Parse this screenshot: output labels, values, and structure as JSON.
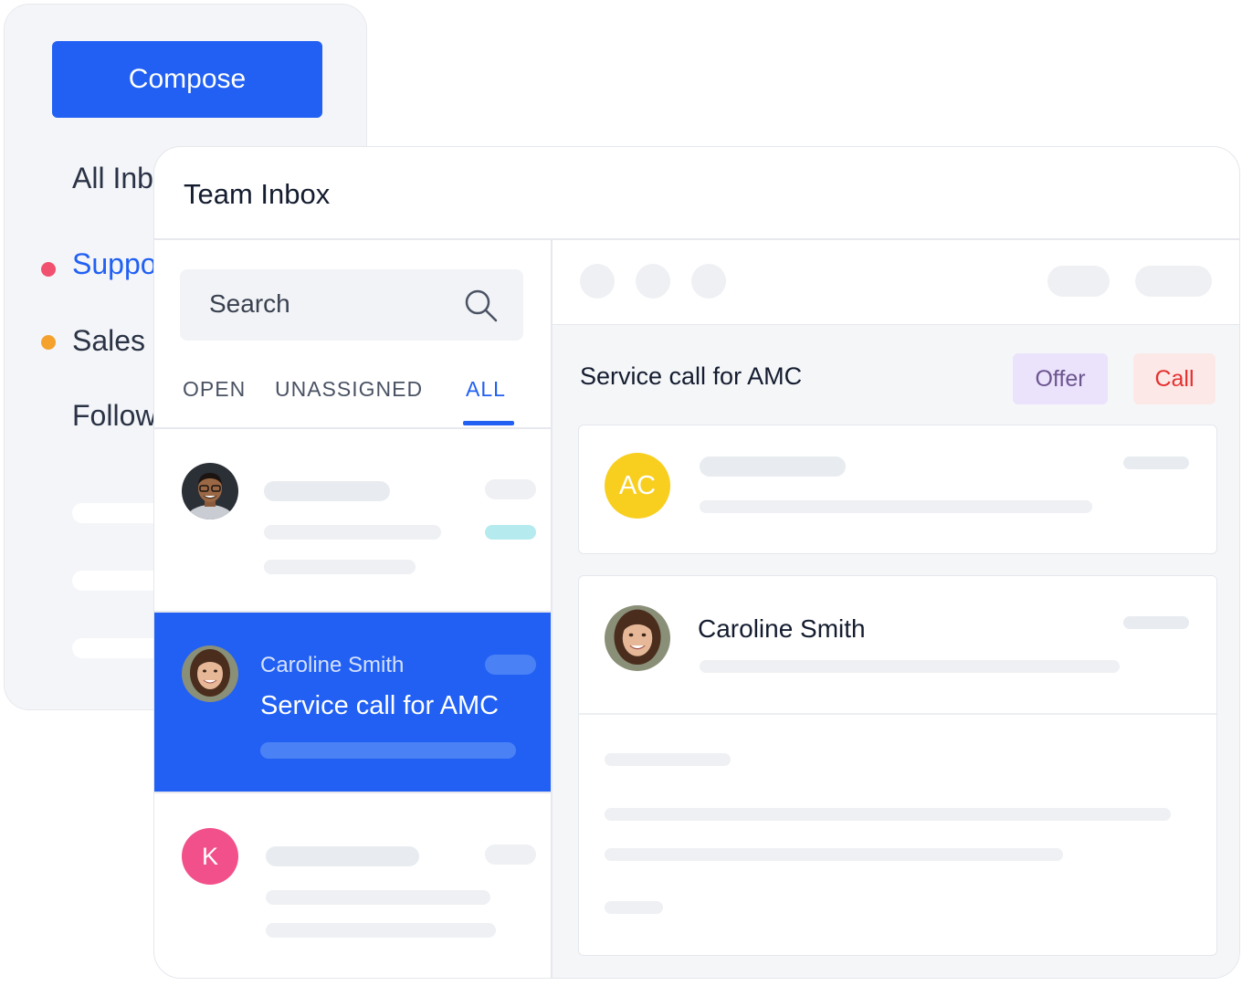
{
  "sidebar": {
    "compose_label": "Compose",
    "items": [
      {
        "label": "All Inbox",
        "dot_color": null,
        "active": false
      },
      {
        "label": "Support",
        "dot_color": "#f2506f",
        "active": true
      },
      {
        "label": "Sales",
        "dot_color": "#f5a12e",
        "active": false
      },
      {
        "label": "Follow",
        "dot_color": null,
        "active": false
      }
    ]
  },
  "header": {
    "title": "Team Inbox"
  },
  "search": {
    "placeholder": "Search",
    "icon": "search-icon"
  },
  "tabs": [
    {
      "label": "OPEN",
      "active": false
    },
    {
      "label": "UNASSIGNED",
      "active": false
    },
    {
      "label": "ALL",
      "active": true
    }
  ],
  "conversations": [
    {
      "avatar": "man-photo-avatar"
    },
    {
      "avatar": "woman-photo-avatar",
      "name": "Caroline Smith",
      "subject": "Service call for AMC",
      "selected": true
    },
    {
      "avatar_initial": "K",
      "avatar_color": "#f2508a"
    }
  ],
  "detail": {
    "subject": "Service call for AMC",
    "tags": [
      {
        "label": "Offer",
        "bg": "#ebe2fc",
        "color": "#6c558f"
      },
      {
        "label": "Call",
        "bg": "#fde8e8",
        "color": "#e4312f"
      }
    ],
    "cards": [
      {
        "avatar_initials": "AC",
        "avatar_color": "#f8cf1f"
      },
      {
        "avatar": "woman-photo-avatar",
        "name": "Caroline Smith"
      }
    ]
  },
  "colors": {
    "accent": "#2160f3"
  }
}
